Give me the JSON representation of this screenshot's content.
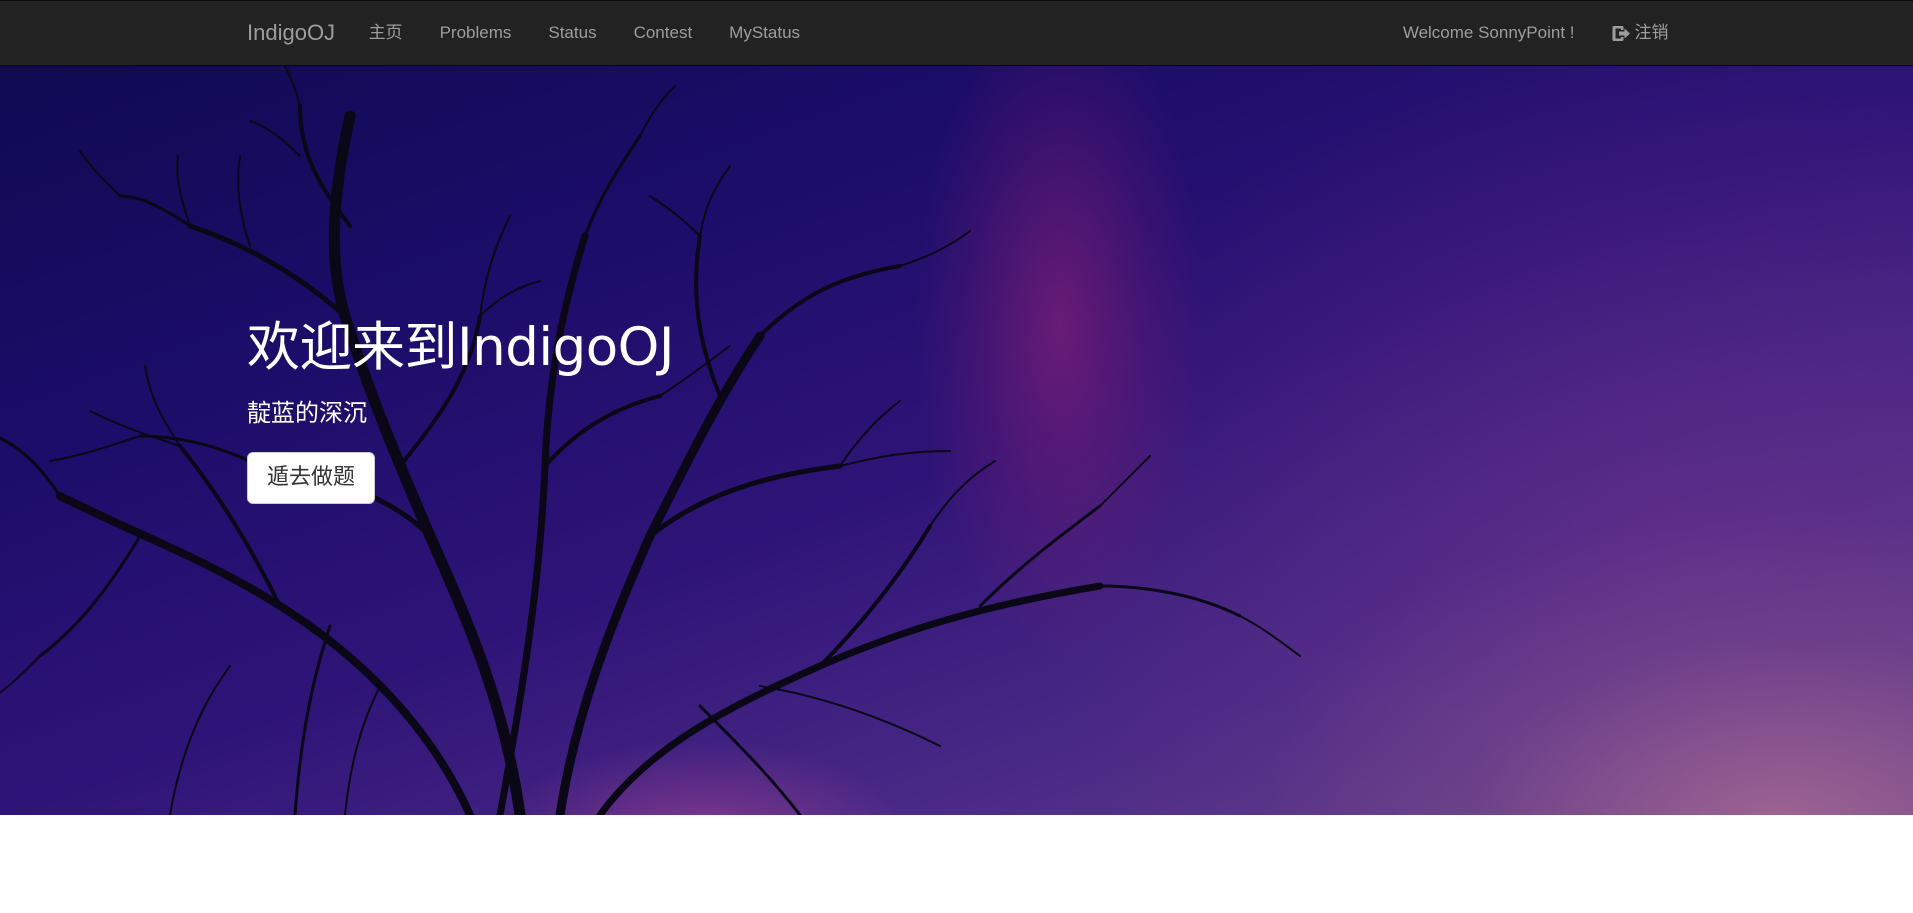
{
  "navbar": {
    "brand": "IndigoOJ",
    "links": [
      {
        "label": "主页"
      },
      {
        "label": "Problems"
      },
      {
        "label": "Status"
      },
      {
        "label": "Contest"
      },
      {
        "label": "MyStatus"
      }
    ],
    "welcome": "Welcome SonnyPoint !",
    "logout_label": "注销",
    "logout_icon": "logout-icon"
  },
  "hero": {
    "title": "欢迎来到IndigoOJ",
    "subtitle": "靛蓝的深沉",
    "button_label": "遁去做题"
  },
  "colors": {
    "navbar_bg": "#222222",
    "nav_text": "#9d9d9d",
    "hero_top": "#0f0a52",
    "hero_bottom_right": "#6a4a88",
    "button_bg": "#ffffff"
  }
}
